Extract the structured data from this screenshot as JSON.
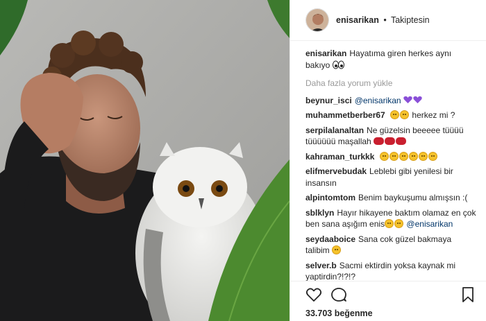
{
  "header": {
    "username": "enisarikan",
    "separator": "•",
    "follow_status": "Takiptesin"
  },
  "caption": {
    "author": "enisarikan",
    "text": "Hayatıma giren herkes aynı bakıyo",
    "emoji": "eyes-emoji"
  },
  "load_more": "Daha fazla yorum yükle",
  "comments": [
    {
      "author": "beynur_isci",
      "mention": "@enisarikan",
      "text": "",
      "emojis": [
        "purple-heart",
        "purple-heart"
      ]
    },
    {
      "author": "muhammetberber67",
      "lead_emojis": [
        "grin",
        "face"
      ],
      "text": "herkez mi ?"
    },
    {
      "author": "serpilalanaltan",
      "text": "Ne güzelsin beeeee tüüüü tüüüüüü maşallah",
      "emojis": [
        "red",
        "red",
        "red"
      ]
    },
    {
      "author": "kahraman_turkkk",
      "text": "",
      "emojis": [
        "cry",
        "cry",
        "cry",
        "cry",
        "cry",
        "cry"
      ]
    },
    {
      "author": "elifmervebudak",
      "text": "Leblebi gibi yenilesi bir insansın"
    },
    {
      "author": "alpintomtom",
      "text": "Benim baykuşumu almışsın :("
    },
    {
      "author": "sblklyn",
      "text": "Hayır hikayene baktım olamaz en çok ben sana aşığım enis",
      "emojis": [
        "smile",
        "heart-eyes"
      ],
      "mention": "@enisarikan"
    },
    {
      "author": "seydaaboice",
      "text": "Sana cok güzel bakmaya talibim",
      "emojis": [
        "grin"
      ]
    },
    {
      "author": "selver.b",
      "text": "Sacmi ektirdin yoksa kaynak mi yaptirdin?!?!?"
    }
  ],
  "actions": {
    "like_icon": "heart-icon",
    "comment_icon": "comment-icon",
    "save_icon": "bookmark-icon"
  },
  "likes": "33.703 beğenme",
  "colors": {
    "mention": "#003569",
    "muted": "#999999",
    "text": "#262626"
  }
}
